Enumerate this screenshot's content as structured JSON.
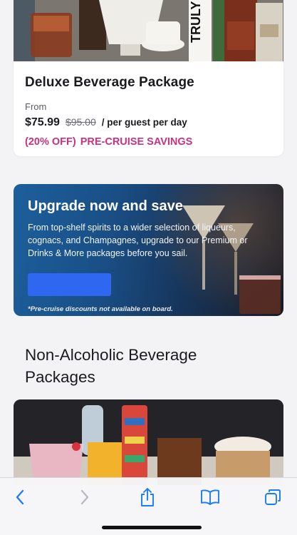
{
  "deluxe_card": {
    "title": "Deluxe Beverage Package",
    "from_label": "From",
    "price": "$75.99",
    "old_price": "$95.00",
    "per_label": "/ per guest per day",
    "discount": "(20% OFF)",
    "savings": "PRE-CRUISE SAVINGS",
    "photo_can_text": "TRULY"
  },
  "upgrade_banner": {
    "title": "Upgrade now and save",
    "text": "From top-shelf spirits to a wider selection of liqueurs, cognacs, and Champagnes, upgrade to our Premium or Drinks & More packages before you sail.",
    "button_label": "",
    "note": "*Pre-cruise discounts not available on board."
  },
  "section": {
    "title": "Non-Alcoholic Beverage Packages"
  },
  "toolbar": {
    "icons": [
      "back-icon",
      "forward-icon",
      "share-icon",
      "bookmarks-icon",
      "tabs-icon"
    ],
    "accent": "#1a7cf5",
    "disabled": "#b8b8be"
  },
  "colors": {
    "savings": "#c9327d",
    "button": "#2f67f0"
  }
}
